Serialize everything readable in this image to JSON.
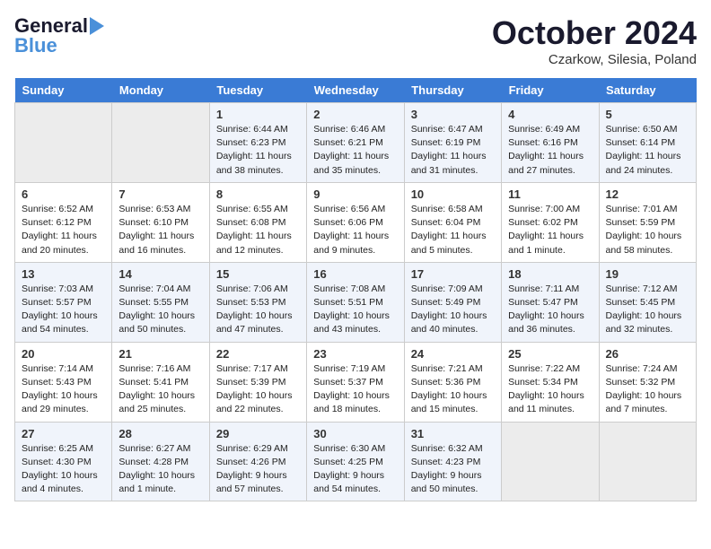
{
  "header": {
    "logo_line1": "General",
    "logo_line2": "Blue",
    "month_title": "October 2024",
    "location": "Czarkow, Silesia, Poland"
  },
  "weekdays": [
    "Sunday",
    "Monday",
    "Tuesday",
    "Wednesday",
    "Thursday",
    "Friday",
    "Saturday"
  ],
  "weeks": [
    [
      {
        "day": "",
        "info": ""
      },
      {
        "day": "",
        "info": ""
      },
      {
        "day": "1",
        "info": "Sunrise: 6:44 AM\nSunset: 6:23 PM\nDaylight: 11 hours\nand 38 minutes."
      },
      {
        "day": "2",
        "info": "Sunrise: 6:46 AM\nSunset: 6:21 PM\nDaylight: 11 hours\nand 35 minutes."
      },
      {
        "day": "3",
        "info": "Sunrise: 6:47 AM\nSunset: 6:19 PM\nDaylight: 11 hours\nand 31 minutes."
      },
      {
        "day": "4",
        "info": "Sunrise: 6:49 AM\nSunset: 6:16 PM\nDaylight: 11 hours\nand 27 minutes."
      },
      {
        "day": "5",
        "info": "Sunrise: 6:50 AM\nSunset: 6:14 PM\nDaylight: 11 hours\nand 24 minutes."
      }
    ],
    [
      {
        "day": "6",
        "info": "Sunrise: 6:52 AM\nSunset: 6:12 PM\nDaylight: 11 hours\nand 20 minutes."
      },
      {
        "day": "7",
        "info": "Sunrise: 6:53 AM\nSunset: 6:10 PM\nDaylight: 11 hours\nand 16 minutes."
      },
      {
        "day": "8",
        "info": "Sunrise: 6:55 AM\nSunset: 6:08 PM\nDaylight: 11 hours\nand 12 minutes."
      },
      {
        "day": "9",
        "info": "Sunrise: 6:56 AM\nSunset: 6:06 PM\nDaylight: 11 hours\nand 9 minutes."
      },
      {
        "day": "10",
        "info": "Sunrise: 6:58 AM\nSunset: 6:04 PM\nDaylight: 11 hours\nand 5 minutes."
      },
      {
        "day": "11",
        "info": "Sunrise: 7:00 AM\nSunset: 6:02 PM\nDaylight: 11 hours\nand 1 minute."
      },
      {
        "day": "12",
        "info": "Sunrise: 7:01 AM\nSunset: 5:59 PM\nDaylight: 10 hours\nand 58 minutes."
      }
    ],
    [
      {
        "day": "13",
        "info": "Sunrise: 7:03 AM\nSunset: 5:57 PM\nDaylight: 10 hours\nand 54 minutes."
      },
      {
        "day": "14",
        "info": "Sunrise: 7:04 AM\nSunset: 5:55 PM\nDaylight: 10 hours\nand 50 minutes."
      },
      {
        "day": "15",
        "info": "Sunrise: 7:06 AM\nSunset: 5:53 PM\nDaylight: 10 hours\nand 47 minutes."
      },
      {
        "day": "16",
        "info": "Sunrise: 7:08 AM\nSunset: 5:51 PM\nDaylight: 10 hours\nand 43 minutes."
      },
      {
        "day": "17",
        "info": "Sunrise: 7:09 AM\nSunset: 5:49 PM\nDaylight: 10 hours\nand 40 minutes."
      },
      {
        "day": "18",
        "info": "Sunrise: 7:11 AM\nSunset: 5:47 PM\nDaylight: 10 hours\nand 36 minutes."
      },
      {
        "day": "19",
        "info": "Sunrise: 7:12 AM\nSunset: 5:45 PM\nDaylight: 10 hours\nand 32 minutes."
      }
    ],
    [
      {
        "day": "20",
        "info": "Sunrise: 7:14 AM\nSunset: 5:43 PM\nDaylight: 10 hours\nand 29 minutes."
      },
      {
        "day": "21",
        "info": "Sunrise: 7:16 AM\nSunset: 5:41 PM\nDaylight: 10 hours\nand 25 minutes."
      },
      {
        "day": "22",
        "info": "Sunrise: 7:17 AM\nSunset: 5:39 PM\nDaylight: 10 hours\nand 22 minutes."
      },
      {
        "day": "23",
        "info": "Sunrise: 7:19 AM\nSunset: 5:37 PM\nDaylight: 10 hours\nand 18 minutes."
      },
      {
        "day": "24",
        "info": "Sunrise: 7:21 AM\nSunset: 5:36 PM\nDaylight: 10 hours\nand 15 minutes."
      },
      {
        "day": "25",
        "info": "Sunrise: 7:22 AM\nSunset: 5:34 PM\nDaylight: 10 hours\nand 11 minutes."
      },
      {
        "day": "26",
        "info": "Sunrise: 7:24 AM\nSunset: 5:32 PM\nDaylight: 10 hours\nand 7 minutes."
      }
    ],
    [
      {
        "day": "27",
        "info": "Sunrise: 6:25 AM\nSunset: 4:30 PM\nDaylight: 10 hours\nand 4 minutes."
      },
      {
        "day": "28",
        "info": "Sunrise: 6:27 AM\nSunset: 4:28 PM\nDaylight: 10 hours\nand 1 minute."
      },
      {
        "day": "29",
        "info": "Sunrise: 6:29 AM\nSunset: 4:26 PM\nDaylight: 9 hours\nand 57 minutes."
      },
      {
        "day": "30",
        "info": "Sunrise: 6:30 AM\nSunset: 4:25 PM\nDaylight: 9 hours\nand 54 minutes."
      },
      {
        "day": "31",
        "info": "Sunrise: 6:32 AM\nSunset: 4:23 PM\nDaylight: 9 hours\nand 50 minutes."
      },
      {
        "day": "",
        "info": ""
      },
      {
        "day": "",
        "info": ""
      }
    ]
  ],
  "row_classes": [
    "row-a",
    "row-b",
    "row-c",
    "row-d",
    "row-e"
  ]
}
